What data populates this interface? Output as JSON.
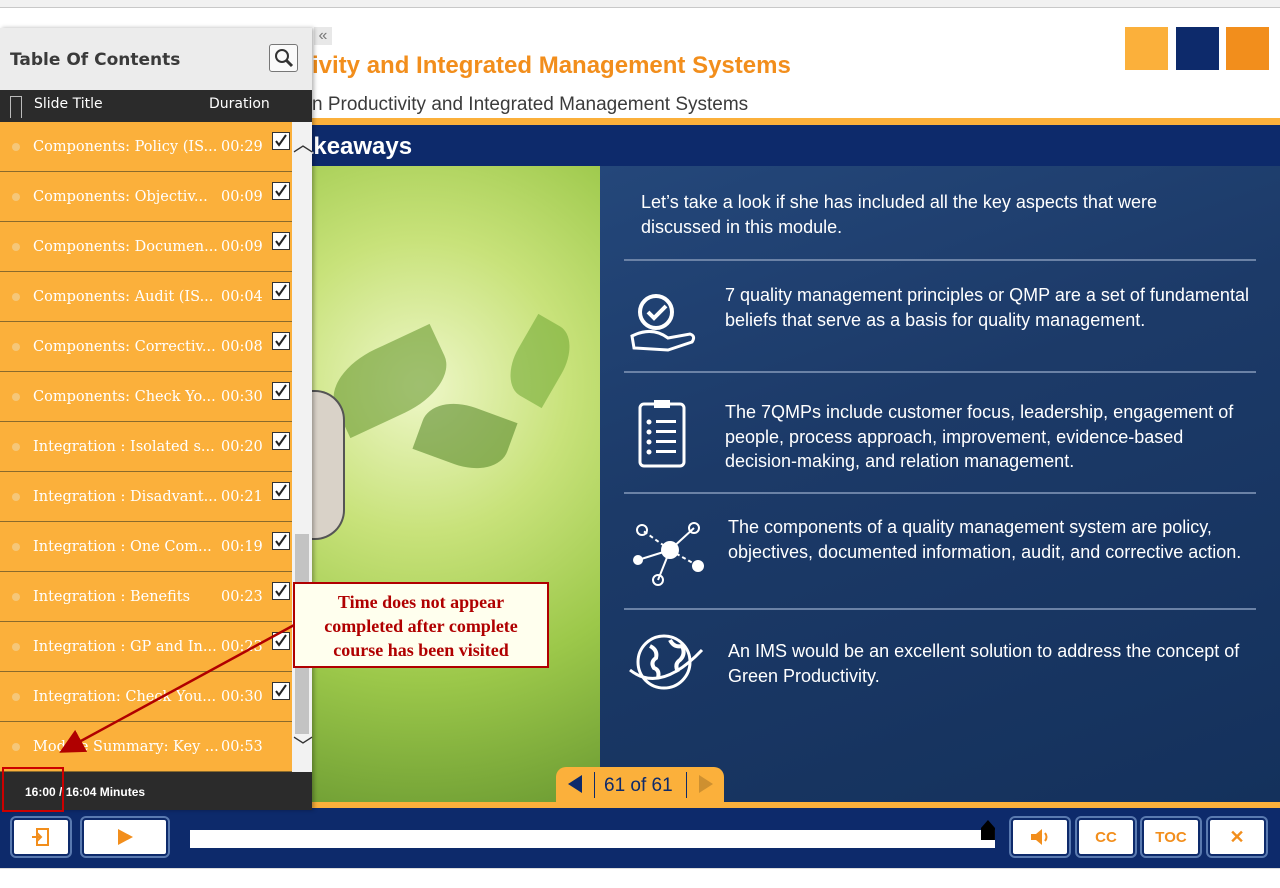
{
  "header": {
    "title": "ivity and Integrated Management Systems",
    "subtitle": "n Productivity and Integrated Management Systems",
    "collapse_icon": "«"
  },
  "section": {
    "title": "akeaways"
  },
  "slide": {
    "intro": "Let’s take a look if she has included all the key aspects that were discussed in this module.",
    "items": [
      {
        "icon": "quality-hand-check-icon",
        "text": "7 quality management principles or QMP are a set of fundamental beliefs that serve as a basis for quality management."
      },
      {
        "icon": "clipboard-checklist-icon",
        "text": "The 7QMPs include customer focus, leadership, engagement of people, process approach, improvement, evidence-based decision-making, and relation management."
      },
      {
        "icon": "network-nodes-icon",
        "text": "The components of a quality management system are policy, objectives, documented information, audit, and corrective action."
      },
      {
        "icon": "globe-icon",
        "text": "An IMS would be an excellent solution to address the concept of Green Productivity."
      }
    ]
  },
  "counter": {
    "text": "61 of 61"
  },
  "toc": {
    "title": "Table Of Contents",
    "col_title": "Slide Title",
    "col_duration": "Duration",
    "rows": [
      {
        "title": "Components: Policy (IS...",
        "duration": "00:29",
        "checked": true
      },
      {
        "title": "Components: Objectiv...",
        "duration": "00:09",
        "checked": true
      },
      {
        "title": "Components: Documen...",
        "duration": "00:09",
        "checked": true
      },
      {
        "title": "Components: Audit (IS...",
        "duration": "00:04",
        "checked": true
      },
      {
        "title": "Components: Correctiv...",
        "duration": "00:08",
        "checked": true
      },
      {
        "title": "Components: Check Yo...",
        "duration": "00:30",
        "checked": true
      },
      {
        "title": "Integration : Isolated s...",
        "duration": "00:20",
        "checked": true
      },
      {
        "title": "Integration : Disadvant...",
        "duration": "00:21",
        "checked": true
      },
      {
        "title": "Integration : One Com...",
        "duration": "00:19",
        "checked": true
      },
      {
        "title": "Integration : Benefits",
        "duration": "00:23",
        "checked": true
      },
      {
        "title": "Integration : GP and In...",
        "duration": "00:23",
        "checked": true
      },
      {
        "title": "Integration: Check You...",
        "duration": "00:30",
        "checked": true
      },
      {
        "title": "Module Summary: Key ...",
        "duration": "00:53",
        "checked": false
      }
    ],
    "footer_time": "16:00 / 16:04 Minutes"
  },
  "controls": {
    "exit_icon": "exit-icon",
    "play_icon": "play-icon",
    "volume_icon": "volume-icon",
    "cc_label": "CC",
    "toc_label": "TOC",
    "close_label": "✕",
    "progress": 0.995
  },
  "annotation": {
    "line1": "Time does not appear",
    "line2": "completed after complete",
    "line3": "course has been visited"
  },
  "colors": {
    "orange": "#fbb03b",
    "dark_orange": "#f28e1c",
    "navy": "#0d2a6b",
    "annotation_red": "#b00000"
  }
}
